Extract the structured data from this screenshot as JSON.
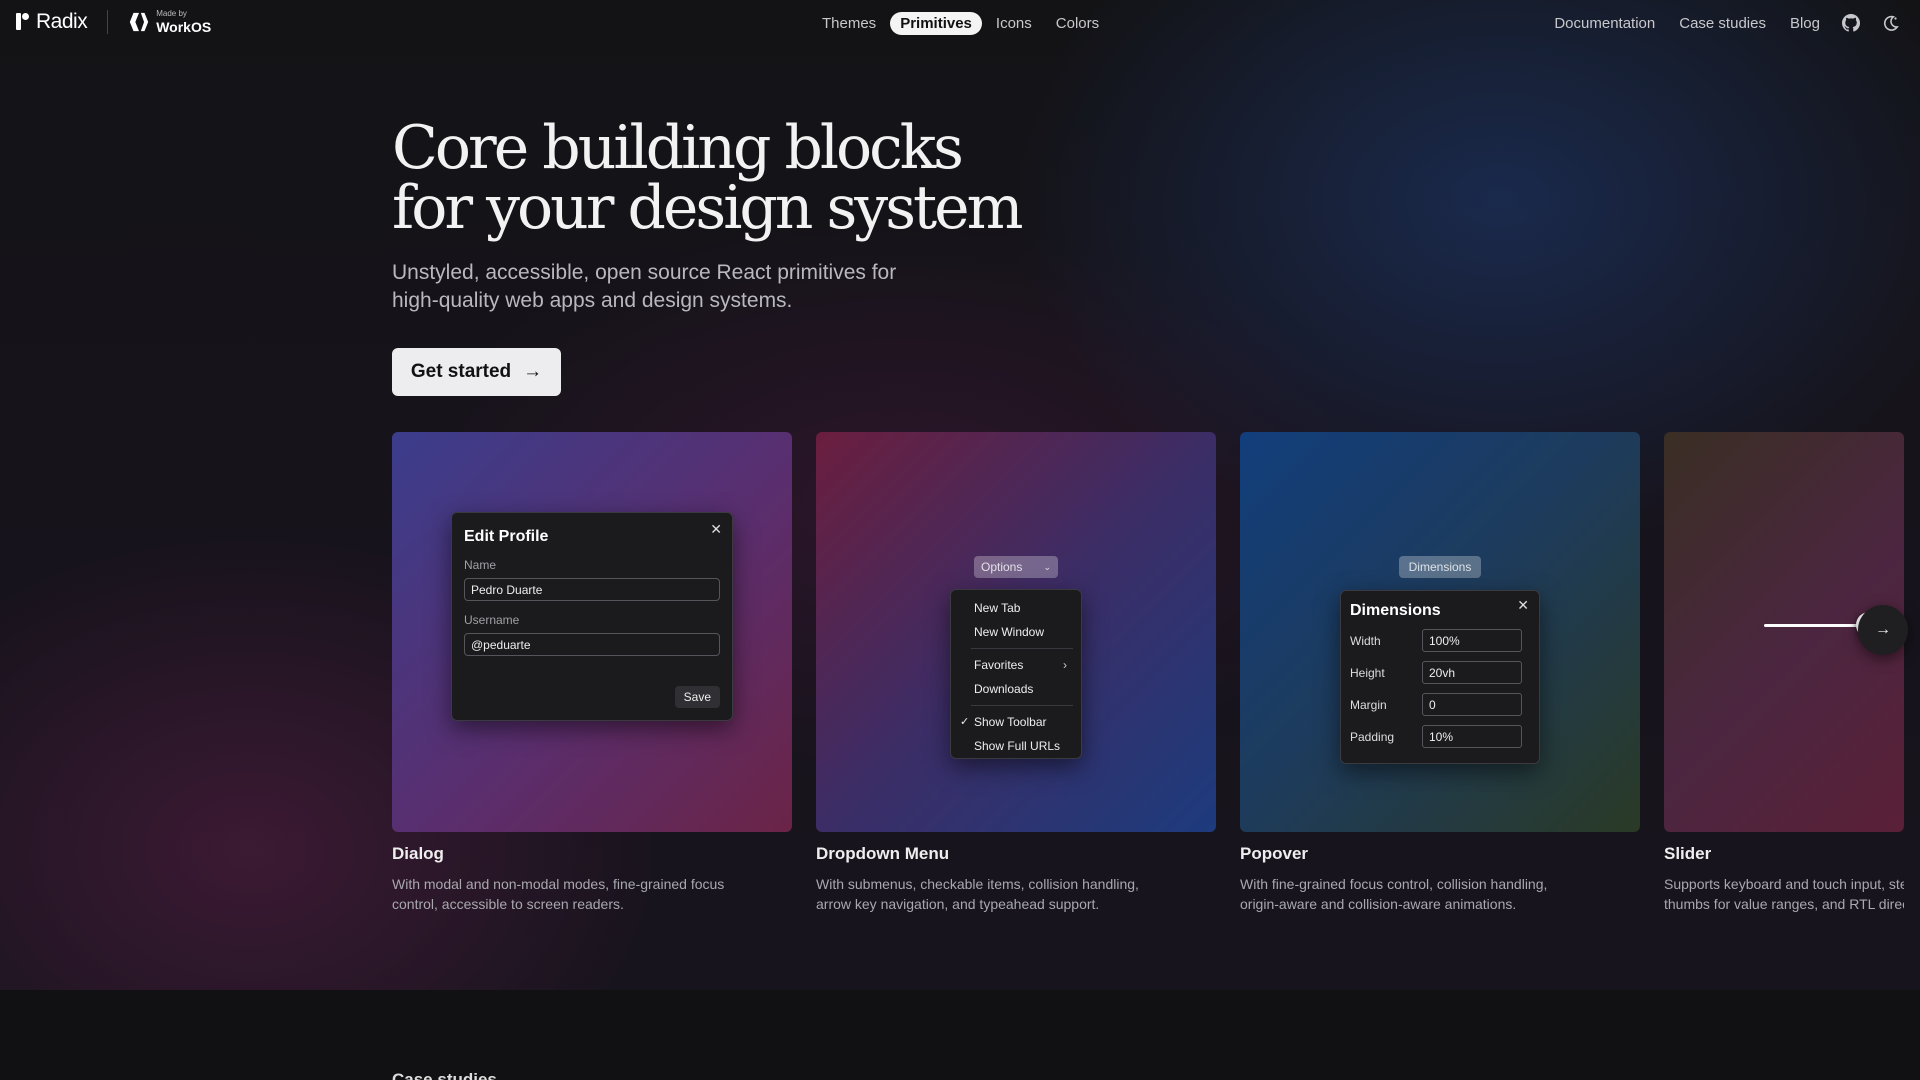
{
  "nav": {
    "brand": "Radix",
    "made_by_small": "Made by",
    "made_by_big": "WorkOS",
    "center": [
      "Themes",
      "Primitives",
      "Icons",
      "Colors"
    ],
    "right": [
      "Documentation",
      "Case studies",
      "Blog"
    ],
    "icons": [
      "github-icon",
      "theme-toggle-icon"
    ]
  },
  "hero": {
    "title": "Core building blocks\nfor your design system",
    "subtitle": "Unstyled, accessible, open source React primitives for high-quality web apps and design systems.",
    "cta": "Get started",
    "cta_icon": "arrow-right-icon"
  },
  "cards": [
    {
      "title": "Dialog",
      "desc": "With modal and non-modal modes, fine-grained focus control, accessible to screen readers.",
      "demo": {
        "title": "Edit Profile",
        "name_label": "Name",
        "name_value": "Pedro Duarte",
        "username_label": "Username",
        "username_value": "@peduarte",
        "save": "Save"
      }
    },
    {
      "title": "Dropdown Menu",
      "desc": "With submenus, checkable items, collision handling, arrow key navigation, and typeahead support.",
      "demo": {
        "trigger": "Options",
        "items": [
          "New Tab",
          "New Window",
          "Favorites",
          "Downloads",
          "Show Toolbar",
          "Show Full URLs"
        ]
      }
    },
    {
      "title": "Popover",
      "desc": "With fine-grained focus control, collision handling, origin-aware and collision-aware animations.",
      "demo": {
        "trigger": "Dimensions",
        "title": "Dimensions",
        "rows": [
          {
            "label": "Width",
            "value": "100%"
          },
          {
            "label": "Height",
            "value": "20vh"
          },
          {
            "label": "Margin",
            "value": "0"
          },
          {
            "label": "Padding",
            "value": "10%"
          }
        ]
      }
    },
    {
      "title": "Slider",
      "desc_line1": "Supports keyboard and touch input, ste",
      "desc_line2": "thumbs for value ranges, and RTL direc"
    }
  ],
  "case_studies_title": "Case studies",
  "colors": {
    "dialog_art": [
      "#3b3d8c",
      "#5a2e6e",
      "#6b2447"
    ],
    "dropdown_art": [
      "#6b1e3e",
      "#3c2d66",
      "#1d3b7d"
    ],
    "popover_art": [
      "#123e7c",
      "#1e3b5a",
      "#2a3a26"
    ],
    "slider_art": [
      "#3a2e24",
      "#4c2640",
      "#5a2038"
    ]
  }
}
